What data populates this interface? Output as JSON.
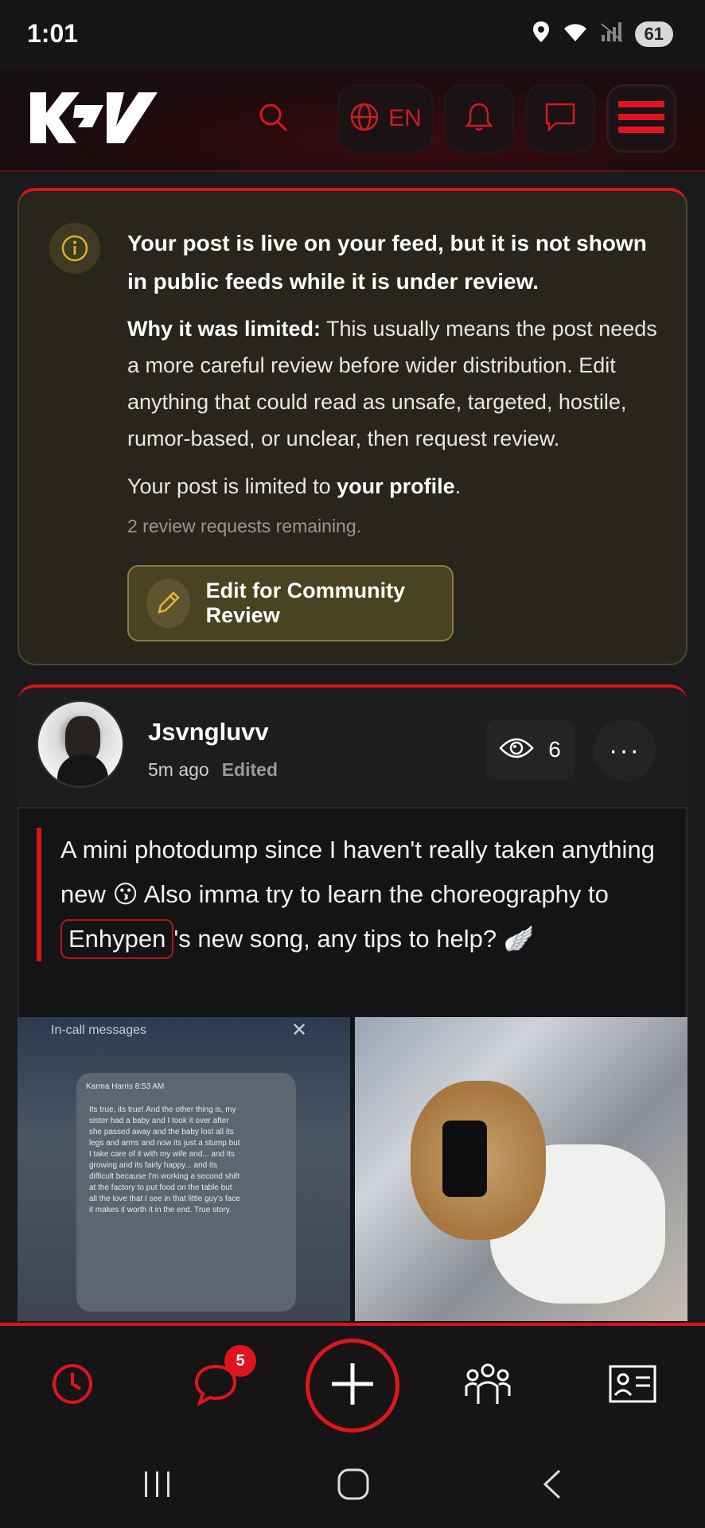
{
  "status_bar": {
    "time": "1:01",
    "battery": "61"
  },
  "header": {
    "logo_text": "KV",
    "language": "EN",
    "icons": [
      "search-icon",
      "globe-icon",
      "bell-icon",
      "chat-icon",
      "menu-icon"
    ],
    "accent_color": "#d8141e"
  },
  "notice": {
    "title": "Your post is live on your feed, but it is not shown in public feeds while it is under review.",
    "why_label": "Why it was limited:",
    "why_text": " This usually means the post needs a more careful review before wider distribution. Edit anything that could read as unsafe, targeted, hostile, rumor-based, or unclear, then request review.",
    "limited_prefix": "Your post is limited to ",
    "limited_target": "your profile",
    "limited_suffix": ".",
    "remaining": "2 review requests remaining.",
    "edit_button": "Edit for Community Review"
  },
  "post": {
    "username": "Jsvngluvv",
    "time_ago": "5m ago",
    "edited": "Edited",
    "views": "6",
    "more": "···",
    "text_part1": "A mini photodump since I haven't really taken anything new 😗 Also imma try to learn the choreography to ",
    "mention": "Enhypen",
    "text_part2": "'s new song, any tips to help? 🪽",
    "photo1": {
      "title": "In-call messages",
      "close": "✕",
      "sender": "Karma Harris  8:53 AM",
      "message": "Its true, its true! And the other thing is, my sister had a baby and I took it over after she passed away and the baby lost all its legs and arms and now its just a stump but I take care of it with my wife and... and its growing and its fairly happy... and its difficult because I'm working a second shift at the factory to put food on the table but all the love that I see in that little guy's face it makes it worth it in the end. True story."
    }
  },
  "bottom_nav": {
    "messages_badge": "5",
    "items": [
      "history-icon",
      "messages-icon",
      "create-icon",
      "community-icon",
      "profile-card-icon"
    ]
  }
}
